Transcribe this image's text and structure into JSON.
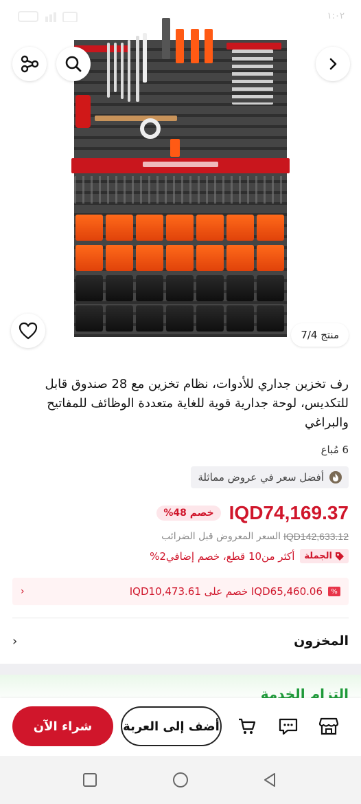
{
  "status_bar": {
    "time": "١:٠٢"
  },
  "gallery": {
    "counter": "منتج 7/4"
  },
  "product": {
    "title": "رف تخزين جداري للأدوات، نظام تخزين مع 28 صندوق قابل للتكديس، لوحة جدارية قوية للغاية متعددة الوظائف للمفاتيح والبراغي",
    "sold": "6 مُباع",
    "best_price_label": "أفضل سعر في عروض مماثلة",
    "price": "IQD74,169.37",
    "discount_badge": "خصم 48%",
    "original_price": "IQD142,633.12",
    "original_price_label": "السعر المعروض قبل الضرائب",
    "bulk_tag": "الجملة",
    "bulk_text": "أكثر من10 قطع، خصم إضافي2%",
    "coupon_text": "IQD65,460.06 خصم على IQD10,473.61"
  },
  "stock": {
    "label": "المخزون"
  },
  "service": {
    "label": "التزام الخدمة"
  },
  "actions": {
    "buy_now": "شراء الآن",
    "add_to_cart": "أضف إلى العربة"
  },
  "colors": {
    "accent": "#d0162b",
    "green": "#1f9a3a"
  }
}
